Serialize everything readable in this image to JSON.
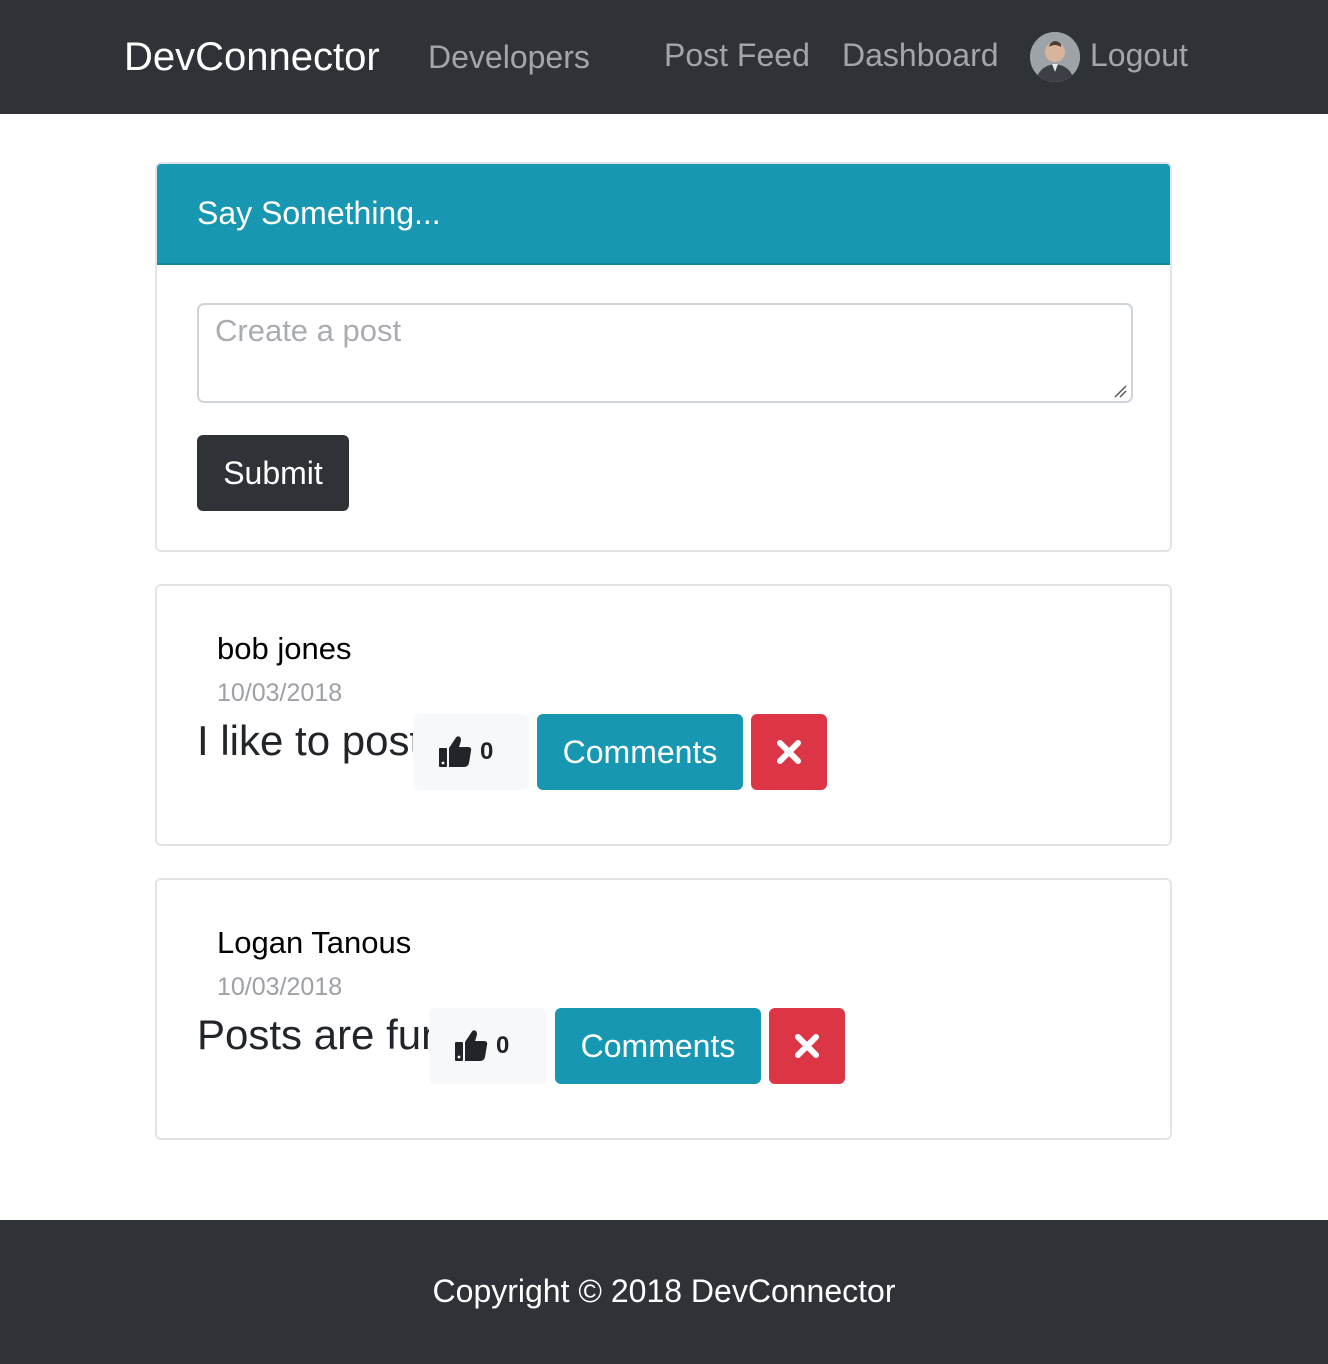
{
  "navbar": {
    "brand": "DevConnector",
    "developers": "Developers",
    "post_feed": "Post Feed",
    "dashboard": "Dashboard",
    "logout": "Logout",
    "avatar_icon": "user-avatar"
  },
  "post_form": {
    "header": "Say Something...",
    "textarea_placeholder": "Create a post",
    "textarea_value": "",
    "submit_label": "Submit"
  },
  "posts": [
    {
      "name": "bob jones",
      "date": "10/03/2018",
      "text": "I like to post",
      "likes": "0",
      "like_icon": "thumbs-up-icon",
      "comments_label": "Comments",
      "delete_icon": "times-icon"
    },
    {
      "name": "Logan Tanous",
      "date": "10/03/2018",
      "text": "Posts are fun",
      "likes": "0",
      "like_icon": "thumbs-up-icon",
      "comments_label": "Comments",
      "delete_icon": "times-icon"
    }
  ],
  "footer": {
    "text": "Copyright © 2018 DevConnector"
  },
  "colors": {
    "navbar_bg": "#2f3338",
    "info": "#1797b1",
    "danger": "#dc3545",
    "light": "#f7f8f9"
  }
}
